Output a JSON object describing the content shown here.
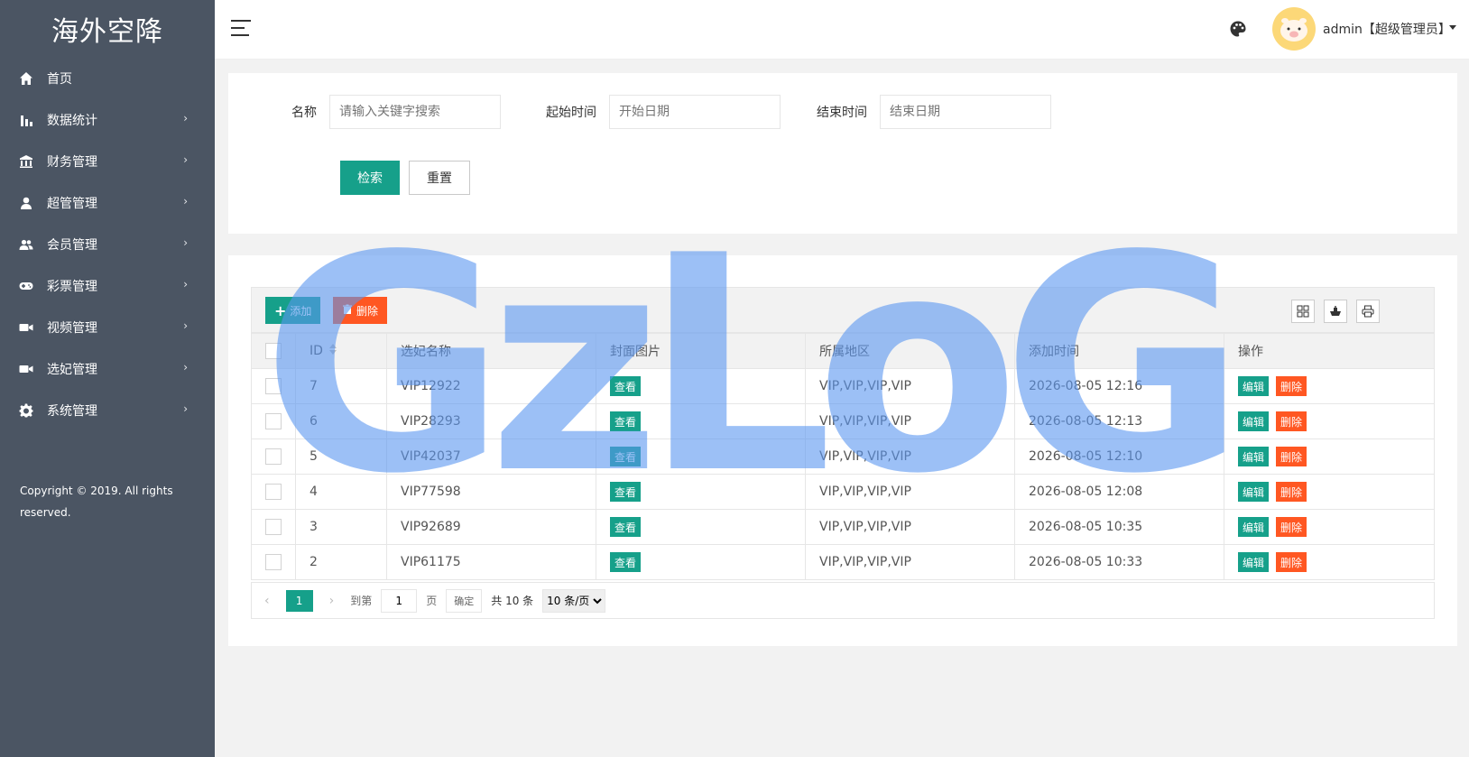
{
  "brand": "海外空降",
  "sidebar": {
    "items": [
      {
        "label": "首页",
        "icon": "home-icon",
        "chevron": ""
      },
      {
        "label": "数据统计",
        "icon": "bar-chart-icon",
        "chevron": "›"
      },
      {
        "label": "财务管理",
        "icon": "bank-icon",
        "chevron": "›"
      },
      {
        "label": "超管管理",
        "icon": "user-icon",
        "chevron": "›"
      },
      {
        "label": "会员管理",
        "icon": "users-icon",
        "chevron": "›"
      },
      {
        "label": "彩票管理",
        "icon": "gamepad-icon",
        "chevron": "›"
      },
      {
        "label": "视频管理",
        "icon": "video-icon",
        "chevron": "›"
      },
      {
        "label": "选妃管理",
        "icon": "video-icon",
        "chevron": "›"
      },
      {
        "label": "系统管理",
        "icon": "gear-icon",
        "chevron": "›"
      }
    ],
    "copyright": "Copyright © 2019. All rights reserved."
  },
  "header": {
    "user": "admin【超级管理员】"
  },
  "search": {
    "name_label": "名称",
    "name_placeholder": "请输入关键字搜索",
    "start_label": "起始时间",
    "start_placeholder": "开始日期",
    "end_label": "结束时间",
    "end_placeholder": "结束日期",
    "search_button": "检索",
    "reset_button": "重置"
  },
  "toolbar": {
    "add_label": "添加",
    "delete_label": "删除"
  },
  "table": {
    "columns": [
      "ID",
      "选妃名称",
      "封面图片",
      "所属地区",
      "添加时间",
      "操作"
    ],
    "view_label": "查看",
    "edit_label": "编辑",
    "delete_label": "删除",
    "rows": [
      {
        "id": "7",
        "name": "VIP12922",
        "region": "VIP,VIP,VIP,VIP",
        "time": "2026-08-05 12:16"
      },
      {
        "id": "6",
        "name": "VIP28293",
        "region": "VIP,VIP,VIP,VIP",
        "time": "2026-08-05 12:13"
      },
      {
        "id": "5",
        "name": "VIP42037",
        "region": "VIP,VIP,VIP,VIP",
        "time": "2026-08-05 12:10"
      },
      {
        "id": "4",
        "name": "VIP77598",
        "region": "VIP,VIP,VIP,VIP",
        "time": "2026-08-05 12:08"
      },
      {
        "id": "3",
        "name": "VIP92689",
        "region": "VIP,VIP,VIP,VIP",
        "time": "2026-08-05 10:35"
      },
      {
        "id": "2",
        "name": "VIP61175",
        "region": "VIP,VIP,VIP,VIP",
        "time": "2026-08-05 10:33"
      }
    ]
  },
  "pager": {
    "prev": "‹",
    "current": "1",
    "next": "›",
    "goto_label": "到第",
    "goto_value": "1",
    "page_unit": "页",
    "confirm": "确定",
    "total": "共 10 条",
    "page_size": "10 条/页"
  },
  "watermark": "GzLoG"
}
